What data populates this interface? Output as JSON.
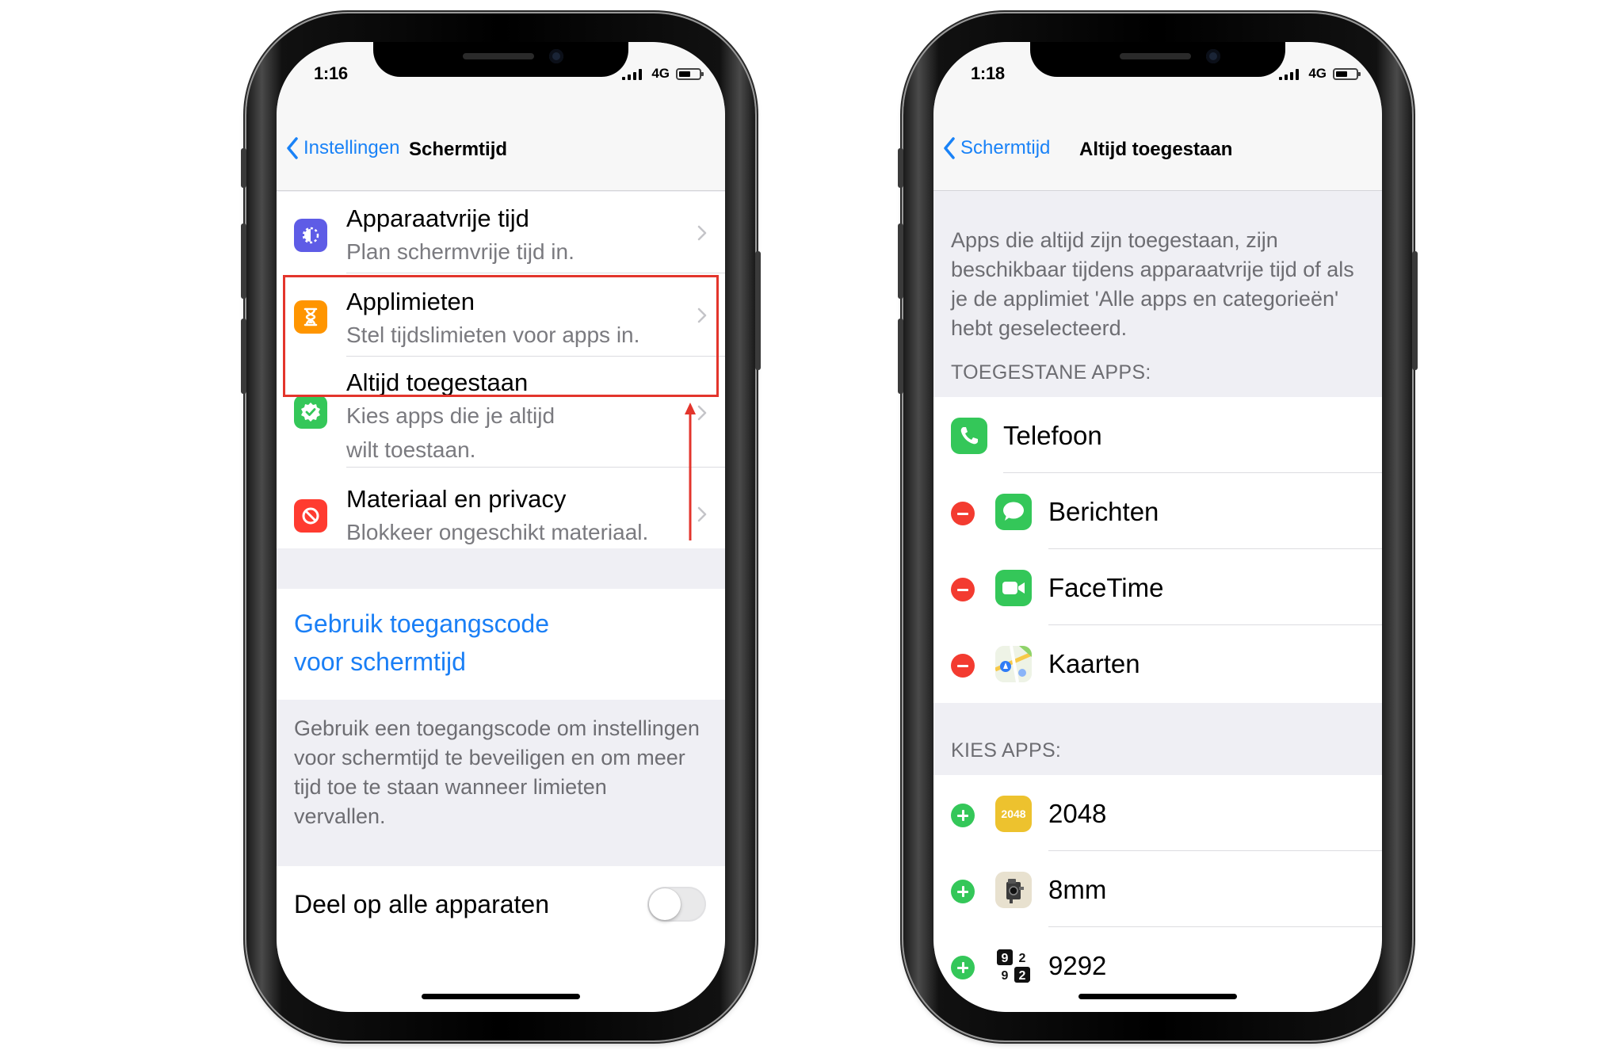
{
  "left_phone": {
    "status": {
      "time": "1:16",
      "network": "4G"
    },
    "nav": {
      "back_label": "Instellingen",
      "title": "Schermtijd"
    },
    "items": [
      {
        "title": "Apparaatvrije tijd",
        "subtitle": "Plan schermvrije tijd in.",
        "icon": "downtime-icon",
        "color": "#5e5ce6"
      },
      {
        "title": "Applimieten",
        "subtitle": "Stel tijdslimieten voor apps in.",
        "icon": "hourglass-icon",
        "color": "#ff9500"
      },
      {
        "title": "Altijd toegestaan",
        "subtitle_line1": "Kies apps die je altijd",
        "subtitle_line2": "wilt toestaan.",
        "icon": "check-seal-icon",
        "color": "#34c759"
      },
      {
        "title": "Materiaal en privacy",
        "subtitle": "Blokkeer ongeschikt materiaal.",
        "icon": "restriction-icon",
        "color": "#ff3b30"
      }
    ],
    "passcode_link_line1": "Gebruik toegangscode",
    "passcode_link_line2": "voor schermtijd",
    "passcode_description": "Gebruik een toegangscode om instellingen voor schermtijd te beveiligen en om meer tijd toe te staan wanneer limieten vervallen.",
    "share_label": "Deel op alle apparaten",
    "share_enabled": false,
    "highlight_color": "#e3352c"
  },
  "right_phone": {
    "status": {
      "time": "1:18",
      "network": "4G"
    },
    "nav": {
      "back_label": "Schermtijd",
      "title": "Altijd toegestaan"
    },
    "description": "Apps die altijd zijn toegestaan, zijn beschikbaar tijdens apparaatvrije tijd of als je de applimiet 'Alle apps en categorieën' hebt geselecteerd.",
    "allowed_header": "TOEGESTANE APPS:",
    "allowed_apps": [
      {
        "name": "Telefoon",
        "icon": "phone-icon",
        "removable": false
      },
      {
        "name": "Berichten",
        "icon": "messages-icon",
        "removable": true
      },
      {
        "name": "FaceTime",
        "icon": "facetime-icon",
        "removable": true
      },
      {
        "name": "Kaarten",
        "icon": "maps-icon",
        "removable": true
      }
    ],
    "choose_header": "KIES APPS:",
    "choose_apps": [
      {
        "name": "2048",
        "icon": "app-2048-icon",
        "icon_text": "2048"
      },
      {
        "name": "8mm",
        "icon": "camera-8mm-icon"
      },
      {
        "name": "9292",
        "icon": "app-9292-icon",
        "icon_text": "9292"
      }
    ]
  },
  "colors": {
    "ios_blue": "#1a7ff6",
    "remove_red": "#f33b30",
    "add_green": "#34c759"
  }
}
